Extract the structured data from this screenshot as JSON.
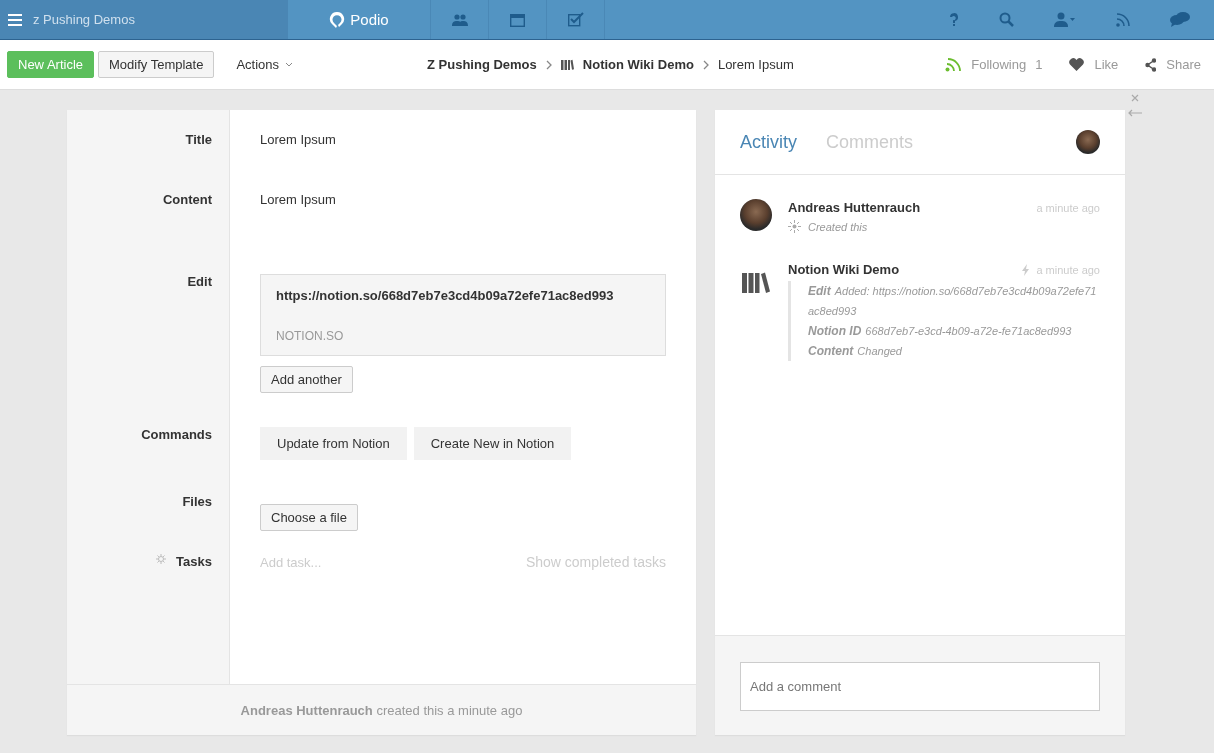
{
  "topbar": {
    "workspace": "z Pushing Demos",
    "logo": "Podio"
  },
  "toolbar": {
    "primary_button": "New Article",
    "secondary_button": "Modify Template",
    "actions": "Actions",
    "breadcrumb": [
      "Z Pushing Demos",
      "Notion Wiki Demo",
      "Lorem Ipsum"
    ],
    "following": {
      "label": "Following",
      "count": "1"
    },
    "like": "Like",
    "share": "Share"
  },
  "fields": [
    {
      "kind": "text",
      "label": "Title",
      "value": "Lorem Ipsum"
    },
    {
      "kind": "text",
      "label": "Content",
      "value": "Lorem Ipsum"
    },
    {
      "kind": "link",
      "label": "Edit",
      "url": "https://notion.so/668d7eb7e3cd4b09a72efe71ac8ed993",
      "domain": "NOTION.SO",
      "button": "Add another"
    },
    {
      "kind": "commands",
      "label": "Commands",
      "buttons": [
        "Update from Notion",
        "Create New in Notion"
      ]
    },
    {
      "kind": "file",
      "label": "Files",
      "button": "Choose a file"
    },
    {
      "kind": "tasks",
      "label": "Tasks",
      "placeholder": "Add task...",
      "link": "Show completed tasks"
    }
  ],
  "footer": "**Andreas Huttenrauch** created this a minute ago",
  "tabs": [
    {
      "label": "Activity",
      "selected": true
    },
    {
      "label": "Comments",
      "selected": false
    }
  ],
  "activity": [
    {
      "kind": "user",
      "title": "Andreas Huttenrauch",
      "time": "a minute ago",
      "note": "Created this"
    },
    {
      "kind": "app",
      "title": "Notion Wiki Demo",
      "time": "a minute ago",
      "changes": [
        {
          "label": "Edit",
          "text": "Added: https://notion.so/668d7eb7e3cd4b09a72efe71ac8ed993"
        },
        {
          "label": "Notion ID",
          "text": "668d7eb7-e3cd-4b09-a72e-fe71ac8ed993"
        },
        {
          "label": "Content",
          "text": "Changed"
        }
      ]
    }
  ],
  "comment": {
    "placeholder": "Add a comment"
  }
}
